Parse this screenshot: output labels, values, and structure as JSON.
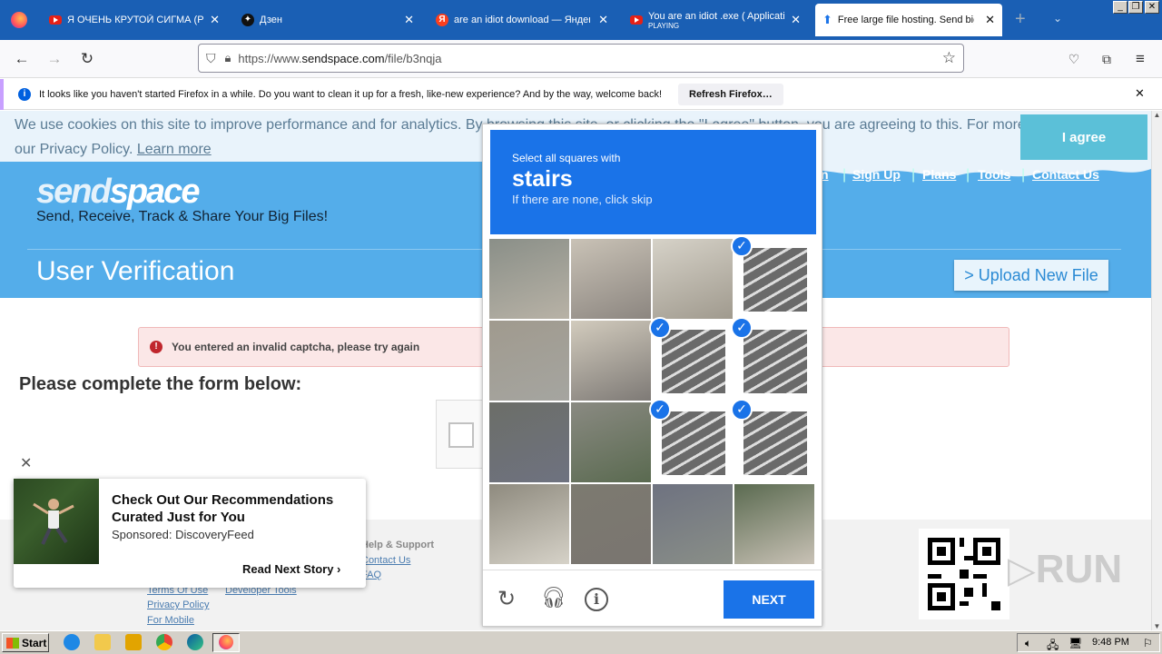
{
  "browser": {
    "tabs": [
      {
        "title": "Я ОЧЕНЬ КРУТОЙ СИГМА (РНС",
        "icon": "youtube-icon"
      },
      {
        "title": "Дзен",
        "icon": "dzen-icon"
      },
      {
        "title": "are an idiot download — Яндекс",
        "icon": "yandex-icon"
      },
      {
        "title": "You are an idiot .exe ( Application",
        "subtitle": "PLAYING",
        "icon": "youtube-icon"
      },
      {
        "title": "Free large file hosting. Send big",
        "icon": "sendspace-icon"
      }
    ],
    "new_tab": "+",
    "url_prefix": "https://www.",
    "url_domain": "sendspace.com",
    "url_path": "/file/b3nqja",
    "notification": "It looks like you haven't started Firefox in a while. Do you want to clean it up for a fresh, like-new experience? And by the way, welcome back!",
    "refresh_button": "Refresh Firefox…"
  },
  "cookie": {
    "text": "We use cookies on this site to improve performance and for analytics. By browsing this site, or clicking the \"I agree\" button, you are agreeing to this. For more information see our Privacy Policy.",
    "learn_more": "Learn more",
    "agree": "I agree"
  },
  "site": {
    "logo_send": "send",
    "logo_space": "space",
    "tagline": "Send, Receive, Track & Share Your Big Files!",
    "nav": [
      "n",
      "Sign Up",
      "Plans",
      "Tools",
      "Contact Us"
    ],
    "heading": "User Verification",
    "upload_button": "> Upload New File",
    "error": "You entered an invalid captcha, please try again",
    "form_heading": "Please complete the form below:",
    "footer_help_title": "Help & Support",
    "footer_help_links": [
      "Contact Us",
      "FAQ"
    ],
    "footer_links": [
      "Terms Of Use",
      "Privacy Policy",
      "For Mobile"
    ],
    "footer_dev": "Developer Tools",
    "watermark": "RUN"
  },
  "captcha": {
    "instruction": "Select all squares with",
    "target": "stairs",
    "hint": "If there are none, click skip",
    "selected": [
      3,
      6,
      7,
      10,
      11
    ],
    "next": "NEXT"
  },
  "ad": {
    "title": "Check Out Our Recommendations Curated Just for You",
    "sponsor": "Sponsored: DiscoveryFeed",
    "cta": "Read Next Story",
    "close": "✕"
  },
  "taskbar": {
    "start": "Start",
    "time": "9:48 PM"
  }
}
